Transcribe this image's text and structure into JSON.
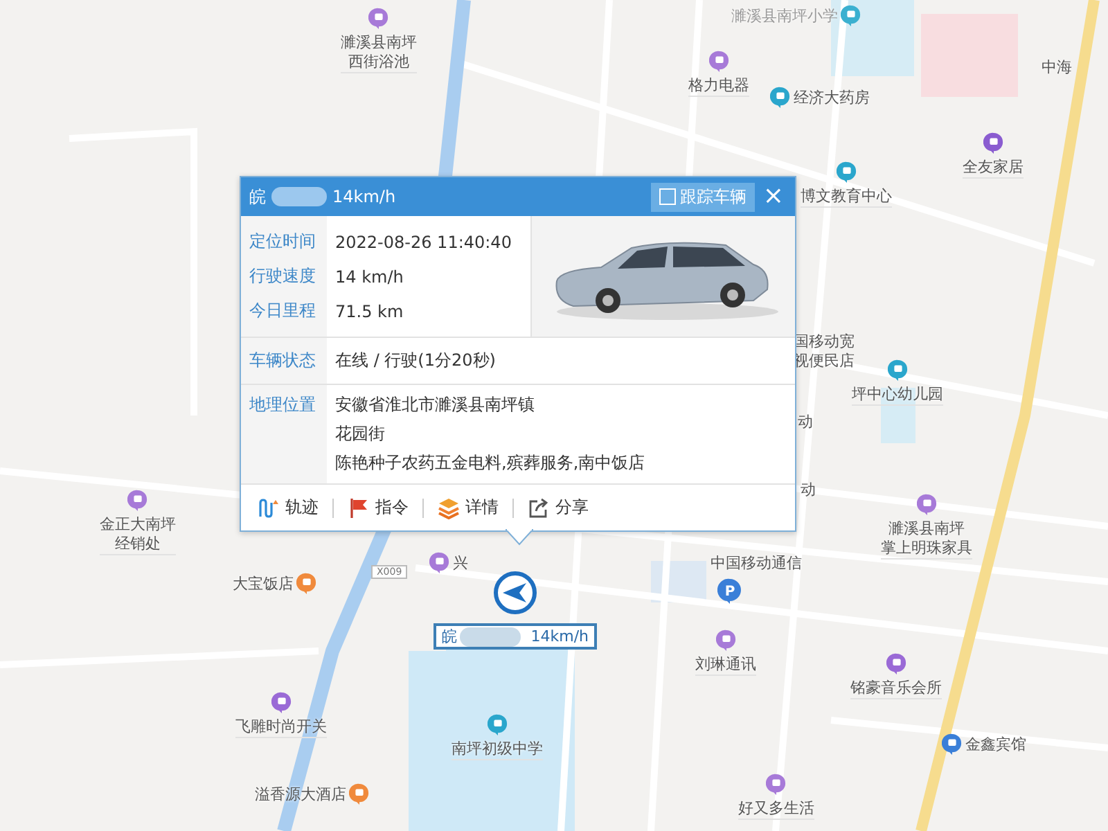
{
  "map": {
    "pois": [
      {
        "lines": [
          "濉溪县南坪",
          "西街浴池"
        ],
        "color": "#a77ad8"
      },
      {
        "lines": [
          "濉溪县南坪小学"
        ],
        "color": "#3bb0d0"
      },
      {
        "lines": [
          "格力电器"
        ],
        "color": "#a77ad8"
      },
      {
        "lines": [
          "经济大药房"
        ],
        "color": "#2aa6cc"
      },
      {
        "lines": [
          "中海"
        ]
      },
      {
        "lines": [
          "全友家居"
        ],
        "color": "#8a5cd0"
      },
      {
        "lines": [
          "博文教育中心"
        ],
        "color": "#2aa6cc"
      },
      {
        "lines": [
          "国移动宽",
          "视便民店"
        ]
      },
      {
        "lines": [
          "坪中心幼儿园"
        ],
        "color": "#2aa6cc"
      },
      {
        "lines": [
          "动"
        ]
      },
      {
        "lines": [
          "动"
        ]
      },
      {
        "lines": [
          "金正大南坪",
          "经销处"
        ],
        "color": "#a77ad8"
      },
      {
        "lines": [
          "濉溪县南坪",
          "掌上明珠家具"
        ],
        "color": "#a77ad8"
      },
      {
        "lines": [
          "中国移动通信"
        ]
      },
      {
        "lines": [
          "大宝饭店"
        ],
        "color": "#f08a3c"
      },
      {
        "lines": [
          "兴"
        ],
        "color": "#a77ad8"
      },
      {
        "lines": [
          "刘琳通讯"
        ],
        "color": "#a77ad8"
      },
      {
        "lines": [
          "铭豪音乐会所"
        ],
        "color": "#9a6ad6"
      },
      {
        "lines": [
          "飞雕时尚开关"
        ],
        "color": "#9a6ad6"
      },
      {
        "lines": [
          "南坪初级中学"
        ],
        "color": "#2aa6cc"
      },
      {
        "lines": [
          "金鑫宾馆"
        ],
        "color": "#3a7fd8"
      },
      {
        "lines": [
          "溢香源大酒店"
        ],
        "color": "#f08a3c"
      },
      {
        "lines": [
          "好又多生活"
        ],
        "color": "#a77ad8"
      }
    ],
    "road_shield": "X009",
    "parking_sign": "P",
    "vehicle_marker": {
      "plate_prefix": "皖",
      "speed": "14km/h"
    }
  },
  "popup": {
    "title_prefix": "皖",
    "title_speed": "14km/h",
    "track_vehicle": {
      "label": "跟踪车辆",
      "checked": false
    },
    "close": "×",
    "fields": [
      {
        "label": "定位时间",
        "value": "2022-08-26 11:40:40"
      },
      {
        "label": "行驶速度",
        "value": "14 km/h"
      },
      {
        "label": "今日里程",
        "value": "71.5 km"
      }
    ],
    "status": {
      "label": "车辆状态",
      "value": "在线 / 行驶(1分20秒)"
    },
    "location": {
      "label": "地理位置",
      "lines": [
        "安徽省淮北市濉溪县南坪镇",
        "花园街",
        "陈艳种子农药五金电料,殡葬服务,南中饭店"
      ]
    },
    "actions": [
      {
        "kind": "track",
        "label": "轨迹"
      },
      {
        "kind": "command",
        "label": "指令"
      },
      {
        "kind": "details",
        "label": "详情"
      },
      {
        "kind": "share",
        "label": "分享"
      }
    ]
  }
}
